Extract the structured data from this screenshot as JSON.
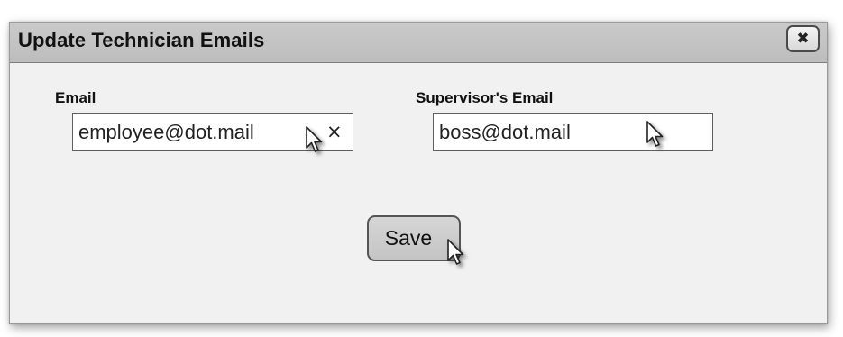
{
  "dialog": {
    "title": "Update Technician Emails",
    "close_icon_glyph": "✖"
  },
  "form": {
    "email": {
      "label": "Email",
      "value": "employee@dot.mail",
      "clear_icon_glyph": "×"
    },
    "supervisor_email": {
      "label": "Supervisor's Email",
      "value": "boss@dot.mail"
    },
    "save_label": "Save"
  },
  "icons": {
    "close": "close-icon",
    "clear": "clear-icon",
    "cursor": "mouse-pointer-icon"
  },
  "colors": {
    "titlebar": "#c3c3c3",
    "dialog_bg": "#f1f1f1",
    "button_bg": "#cccccc"
  }
}
